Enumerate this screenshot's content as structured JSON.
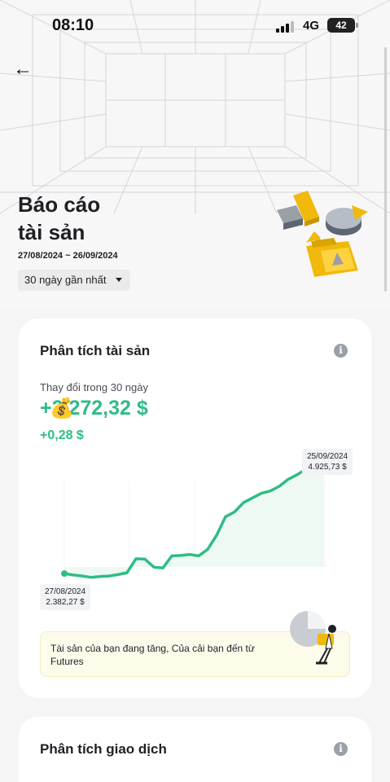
{
  "status_bar": {
    "time": "08:10",
    "network": "4G",
    "battery": "42"
  },
  "header": {
    "back_icon": "arrow-left-icon",
    "title": "Báo cáo\ntài sản",
    "date_range": "27/08/2024 ~ 26/09/2024",
    "period_selector": "30 ngày gần nhất"
  },
  "asset_analysis": {
    "title": "Phân tích tài sản",
    "change_label": "Thay đổi trong 30 ngày",
    "change_amount": "+2.272,32 $",
    "change_sticker": "money-bag-icon",
    "change_percent": "+0,28 $",
    "start_point": {
      "date": "27/08/2024",
      "value": "2.382,27 $"
    },
    "end_point": {
      "date": "25/09/2024",
      "value": "4.925,73 $"
    },
    "insight": "Tài sản của bạn đang tăng, Của cải bạn đến từ Futures"
  },
  "trade_analysis": {
    "title": "Phân tích giao dịch"
  },
  "colors": {
    "accent_green": "#2ebd85",
    "brand_yellow": "#f0b90b",
    "text_primary": "#1e2026",
    "insight_bg": "#fdfbea"
  },
  "chart_data": {
    "type": "line",
    "series": [
      {
        "x": [
          "27/08/2024",
          "28/08/2024",
          "29/08/2024",
          "30/08/2024",
          "31/08/2024",
          "01/09/2024",
          "02/09/2024",
          "03/09/2024",
          "04/09/2024",
          "05/09/2024",
          "06/09/2024",
          "07/09/2024",
          "08/09/2024",
          "09/09/2024",
          "10/09/2024",
          "11/09/2024",
          "12/09/2024",
          "13/09/2024",
          "14/09/2024",
          "15/09/2024",
          "16/09/2024",
          "17/09/2024",
          "18/09/2024",
          "19/09/2024",
          "20/09/2024",
          "21/09/2024",
          "22/09/2024",
          "23/09/2024",
          "24/09/2024",
          "25/09/2024"
        ],
        "values": [
          2382.27,
          2350,
          2330,
          2300,
          2320,
          2330,
          2360,
          2400,
          2700,
          2690,
          2520,
          2500,
          2760,
          2770,
          2790,
          2760,
          2900,
          3200,
          3600,
          3700,
          3900,
          4000,
          4100,
          4150,
          4250,
          4400,
          4500,
          4620,
          4950,
          4925.73
        ]
      }
    ],
    "xlabel": "",
    "ylabel": "",
    "grid": true
  }
}
